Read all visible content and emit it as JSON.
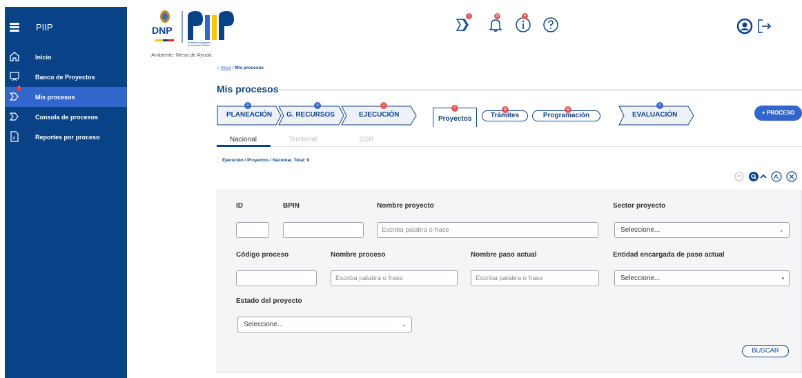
{
  "app": {
    "title": "PIIP",
    "ambiente": "Ambiente: Mesa de Ayuda"
  },
  "logo": {
    "dnp": "DNP",
    "piip_sub_1": "Plataforma Integrada",
    "piip_sub_2": "de Inversión Pública"
  },
  "sidebar": {
    "items": [
      {
        "label": "Inicio",
        "icon": "home-icon"
      },
      {
        "label": "Banco de Proyectos",
        "icon": "bank-icon"
      },
      {
        "label": "Mis procesos",
        "icon": "process-icon",
        "badge": "7"
      },
      {
        "label": "Consola de procesos",
        "icon": "console-icon"
      },
      {
        "label": "Reportes por proceso",
        "icon": "report-icon"
      }
    ]
  },
  "header_icons": {
    "processes_badge": "7",
    "notifications_badge": "13",
    "info_badge": "4"
  },
  "breadcrumb": {
    "home": "Inicio",
    "sep": " / ",
    "current": "Mis procesos"
  },
  "page_title": "Mis procesos",
  "stages": [
    {
      "label": "PLANEACIÓN",
      "badge": "0",
      "badge_color": "#3366cc"
    },
    {
      "label": "G. RECURSOS",
      "badge": "0",
      "badge_color": "#3366cc"
    },
    {
      "label": "EJECUCIÓN",
      "badge": "7",
      "badge_color": "#e05a5a"
    },
    {
      "label": "EVALUACIÓN",
      "badge": "0",
      "badge_color": "#3366cc"
    }
  ],
  "sub_stages": [
    {
      "label": "Proyectos",
      "badge": "7"
    },
    {
      "label": "Trámites",
      "badge": "0"
    },
    {
      "label": "Programación",
      "badge": "0"
    }
  ],
  "add_button": "+ PROCESO",
  "tabs": [
    {
      "label": "Nacional",
      "active": true
    },
    {
      "label": "Territorial",
      "active": false
    },
    {
      "label": "SGR",
      "active": false
    }
  ],
  "result_label": "Ejecución / Proyectos / Nacional. Total: 0",
  "filters": {
    "id_label": "ID",
    "bpin_label": "BPIN",
    "nombre_proyecto_label": "Nombre proyecto",
    "nombre_proyecto_placeholder": "Escriba palabra o frase",
    "sector_label": "Sector proyecto",
    "sector_value": "Seleccione...",
    "codigo_label": "Código proceso",
    "nombre_proceso_label": "Nombre proceso",
    "nombre_proceso_placeholder": "Escriba palabra o frase",
    "paso_label": "Nombre paso actual",
    "paso_placeholder": "Escriba palabra o frase",
    "entidad_label": "Entidad encargada de paso actual",
    "entidad_value": "Seleccione...",
    "estado_label": "Estado del proyecto",
    "estado_value": "Seleccione..."
  },
  "search_button": "BUSCAR",
  "colors": {
    "sidebar": "#0a4287",
    "active": "#3366cc",
    "badge_red": "#e05a5a"
  }
}
